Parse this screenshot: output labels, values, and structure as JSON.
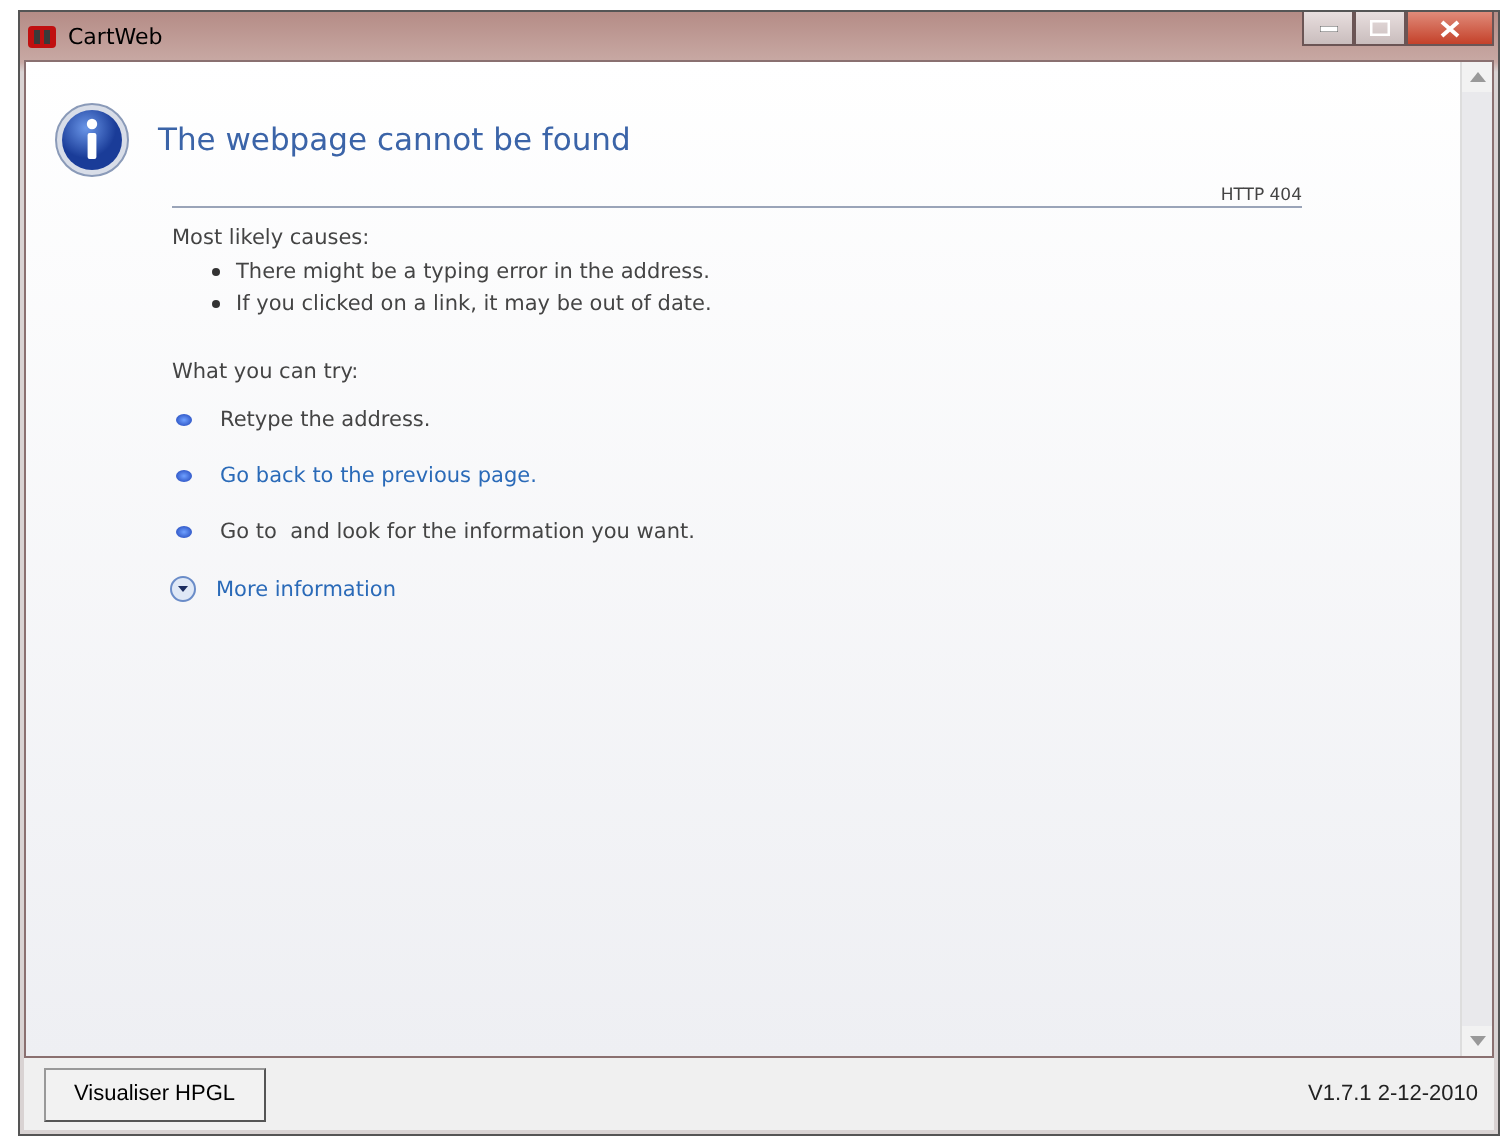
{
  "window": {
    "title": "CartWeb"
  },
  "page": {
    "heading": "The webpage cannot be found",
    "status": "HTTP 404",
    "causes_title": "Most likely causes:",
    "causes": [
      "There might be a typing error in the address.",
      "If you clicked on a link, it may be out of date."
    ],
    "try_title": "What you can try:",
    "tries": [
      {
        "kind": "text",
        "label": "Retype the address."
      },
      {
        "kind": "link",
        "label": "Go back to the previous page."
      },
      {
        "kind": "text",
        "label": "Go to  and look for the information you want."
      }
    ],
    "more": {
      "label": "More information",
      "expanded": false
    }
  },
  "footer": {
    "button": "Visualiser HPGL",
    "version": "V1.7.1 2-12-2010"
  }
}
